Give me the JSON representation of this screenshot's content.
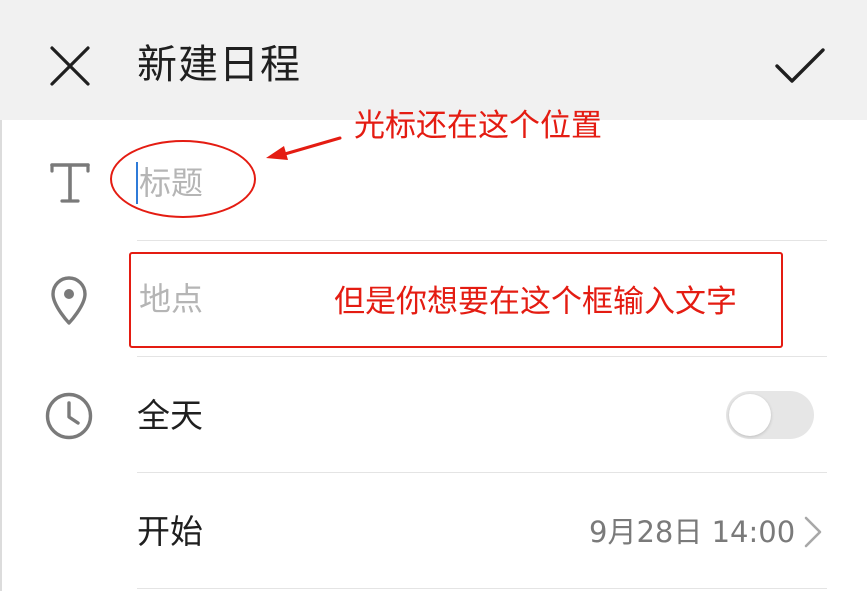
{
  "header": {
    "title": "新建日程"
  },
  "fields": {
    "title_placeholder": "标题",
    "location_placeholder": "地点",
    "all_day_label": "全天",
    "start_label": "开始",
    "start_value": "9月28日 14:00",
    "all_day_on": false
  },
  "annotations": {
    "cursor_note": "光标还在这个位置",
    "box_note": "但是你想要在这个框输入文字"
  },
  "colors": {
    "header_bg": "#f1f1f1",
    "annotation_red": "#e41c12",
    "caret_blue": "#2f7bd8",
    "placeholder_gray": "#b5b5b5"
  },
  "icons": {
    "close": "close-icon",
    "confirm": "check-icon",
    "title": "text-t-icon",
    "location": "location-pin-icon",
    "time": "clock-icon",
    "chevron": "chevron-right-icon"
  }
}
